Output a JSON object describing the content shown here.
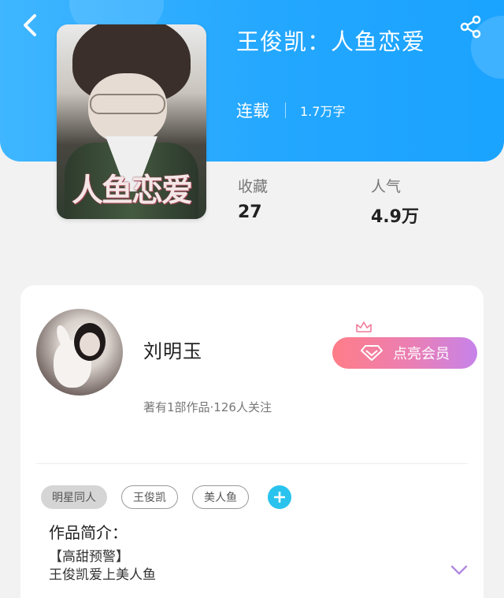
{
  "book": {
    "title": "王俊凯：人鱼恋爱",
    "cover_text": "人鱼恋爱",
    "status": "连载",
    "word_count": "1.7万字"
  },
  "stats": {
    "favorites_label": "收藏",
    "favorites_value": "27",
    "popularity_label": "人气",
    "popularity_value": "4.9万"
  },
  "author": {
    "name": "刘明玉",
    "meta": "著有1部作品·126人关注",
    "member_button": "点亮会员"
  },
  "tags": [
    "明星同人",
    "王俊凯",
    "美人鱼"
  ],
  "intro": {
    "title": "作品简介：",
    "lines": [
      "【高甜预警】",
      "王俊凯爱上美人鱼"
    ]
  },
  "icons": {
    "back": "chevron-left-icon",
    "share": "share-icon",
    "member": "diamond-icon",
    "crown": "crown-icon",
    "add": "plus-icon",
    "expand": "chevron-down-icon"
  },
  "colors": {
    "header": "#23a7ff",
    "tag_add": "#29c3ee",
    "member_gradient_start": "#ff7d88",
    "member_gradient_end": "#c683ea",
    "expand": "#b08ae0"
  }
}
